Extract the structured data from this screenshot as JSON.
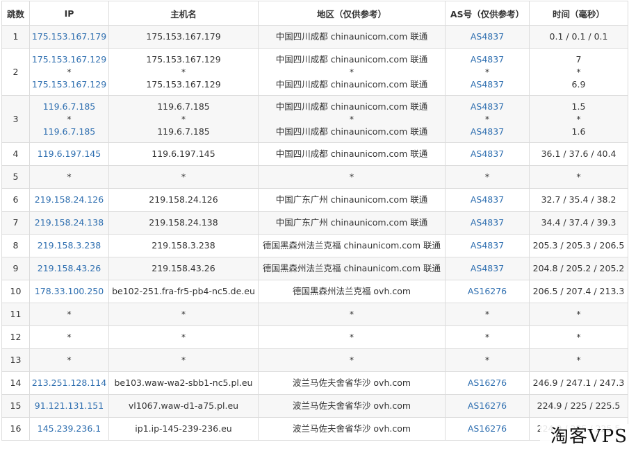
{
  "headers": [
    "跳数",
    "IP",
    "主机名",
    "地区（仅供参考）",
    "AS号（仅供参考）",
    "时间（毫秒）"
  ],
  "rows": [
    {
      "hop": "1",
      "ip": [
        "175.153.167.179"
      ],
      "host": [
        "175.153.167.179"
      ],
      "region": [
        "中国四川成都 chinaunicom.com 联通"
      ],
      "as": [
        "AS4837"
      ],
      "time": [
        "0.1 / 0.1 / 0.1"
      ]
    },
    {
      "hop": "2",
      "ip": [
        "175.153.167.129",
        "*",
        "175.153.167.129"
      ],
      "host": [
        "175.153.167.129",
        "*",
        "175.153.167.129"
      ],
      "region": [
        "中国四川成都 chinaunicom.com 联通",
        "*",
        "中国四川成都 chinaunicom.com 联通"
      ],
      "as": [
        "AS4837",
        "*",
        "AS4837"
      ],
      "time": [
        "7",
        "*",
        "6.9"
      ]
    },
    {
      "hop": "3",
      "ip": [
        "119.6.7.185",
        "*",
        "119.6.7.185"
      ],
      "host": [
        "119.6.7.185",
        "*",
        "119.6.7.185"
      ],
      "region": [
        "中国四川成都 chinaunicom.com 联通",
        "*",
        "中国四川成都 chinaunicom.com 联通"
      ],
      "as": [
        "AS4837",
        "*",
        "AS4837"
      ],
      "time": [
        "1.5",
        "*",
        "1.6"
      ]
    },
    {
      "hop": "4",
      "ip": [
        "119.6.197.145"
      ],
      "host": [
        "119.6.197.145"
      ],
      "region": [
        "中国四川成都 chinaunicom.com 联通"
      ],
      "as": [
        "AS4837"
      ],
      "time": [
        "36.1 / 37.6 / 40.4"
      ]
    },
    {
      "hop": "5",
      "ip": [
        "*"
      ],
      "host": [
        "*"
      ],
      "region": [
        "*"
      ],
      "as": [
        "*"
      ],
      "time": [
        "*"
      ]
    },
    {
      "hop": "6",
      "ip": [
        "219.158.24.126"
      ],
      "host": [
        "219.158.24.126"
      ],
      "region": [
        "中国广东广州 chinaunicom.com 联通"
      ],
      "as": [
        "AS4837"
      ],
      "time": [
        "32.7 / 35.4 / 38.2"
      ]
    },
    {
      "hop": "7",
      "ip": [
        "219.158.24.138"
      ],
      "host": [
        "219.158.24.138"
      ],
      "region": [
        "中国广东广州 chinaunicom.com 联通"
      ],
      "as": [
        "AS4837"
      ],
      "time": [
        "34.4 / 37.4 / 39.3"
      ]
    },
    {
      "hop": "8",
      "ip": [
        "219.158.3.238"
      ],
      "host": [
        "219.158.3.238"
      ],
      "region": [
        "德国黑森州法兰克福 chinaunicom.com 联通"
      ],
      "as": [
        "AS4837"
      ],
      "time": [
        "205.3 / 205.3 / 206.5"
      ]
    },
    {
      "hop": "9",
      "ip": [
        "219.158.43.26"
      ],
      "host": [
        "219.158.43.26"
      ],
      "region": [
        "德国黑森州法兰克福 chinaunicom.com 联通"
      ],
      "as": [
        "AS4837"
      ],
      "time": [
        "204.8 / 205.2 / 205.2"
      ]
    },
    {
      "hop": "10",
      "ip": [
        "178.33.100.250"
      ],
      "host": [
        "be102-251.fra-fr5-pb4-nc5.de.eu"
      ],
      "region": [
        "德国黑森州法兰克福 ovh.com"
      ],
      "as": [
        "AS16276"
      ],
      "time": [
        "206.5 / 207.4 / 213.3"
      ]
    },
    {
      "hop": "11",
      "ip": [
        "*"
      ],
      "host": [
        "*"
      ],
      "region": [
        "*"
      ],
      "as": [
        "*"
      ],
      "time": [
        "*"
      ]
    },
    {
      "hop": "12",
      "ip": [
        "*"
      ],
      "host": [
        "*"
      ],
      "region": [
        "*"
      ],
      "as": [
        "*"
      ],
      "time": [
        "*"
      ]
    },
    {
      "hop": "13",
      "ip": [
        "*"
      ],
      "host": [
        "*"
      ],
      "region": [
        "*"
      ],
      "as": [
        "*"
      ],
      "time": [
        "*"
      ]
    },
    {
      "hop": "14",
      "ip": [
        "213.251.128.114"
      ],
      "host": [
        "be103.waw-wa2-sbb1-nc5.pl.eu"
      ],
      "region": [
        "波兰马佐夫舍省华沙 ovh.com"
      ],
      "as": [
        "AS16276"
      ],
      "time": [
        "246.9 / 247.1 / 247.3"
      ]
    },
    {
      "hop": "15",
      "ip": [
        "91.121.131.151"
      ],
      "host": [
        "vl1067.waw-d1-a75.pl.eu"
      ],
      "region": [
        "波兰马佐夫舍省华沙 ovh.com"
      ],
      "as": [
        "AS16276"
      ],
      "time": [
        "224.9 / 225 / 225.5"
      ]
    },
    {
      "hop": "16",
      "ip": [
        "145.239.236.1"
      ],
      "host": [
        "ip1.ip-145-239-236.eu"
      ],
      "region": [
        "波兰马佐夫舍省华沙 ovh.com"
      ],
      "as": [
        "AS16276"
      ],
      "time": [
        "224.9 / 225 / 225.5"
      ]
    }
  ],
  "watermark": "淘客VPS",
  "colors": {
    "link": "#2f6fb0",
    "border": "#dcdcdc",
    "row_alt": "#f7f7f7"
  }
}
